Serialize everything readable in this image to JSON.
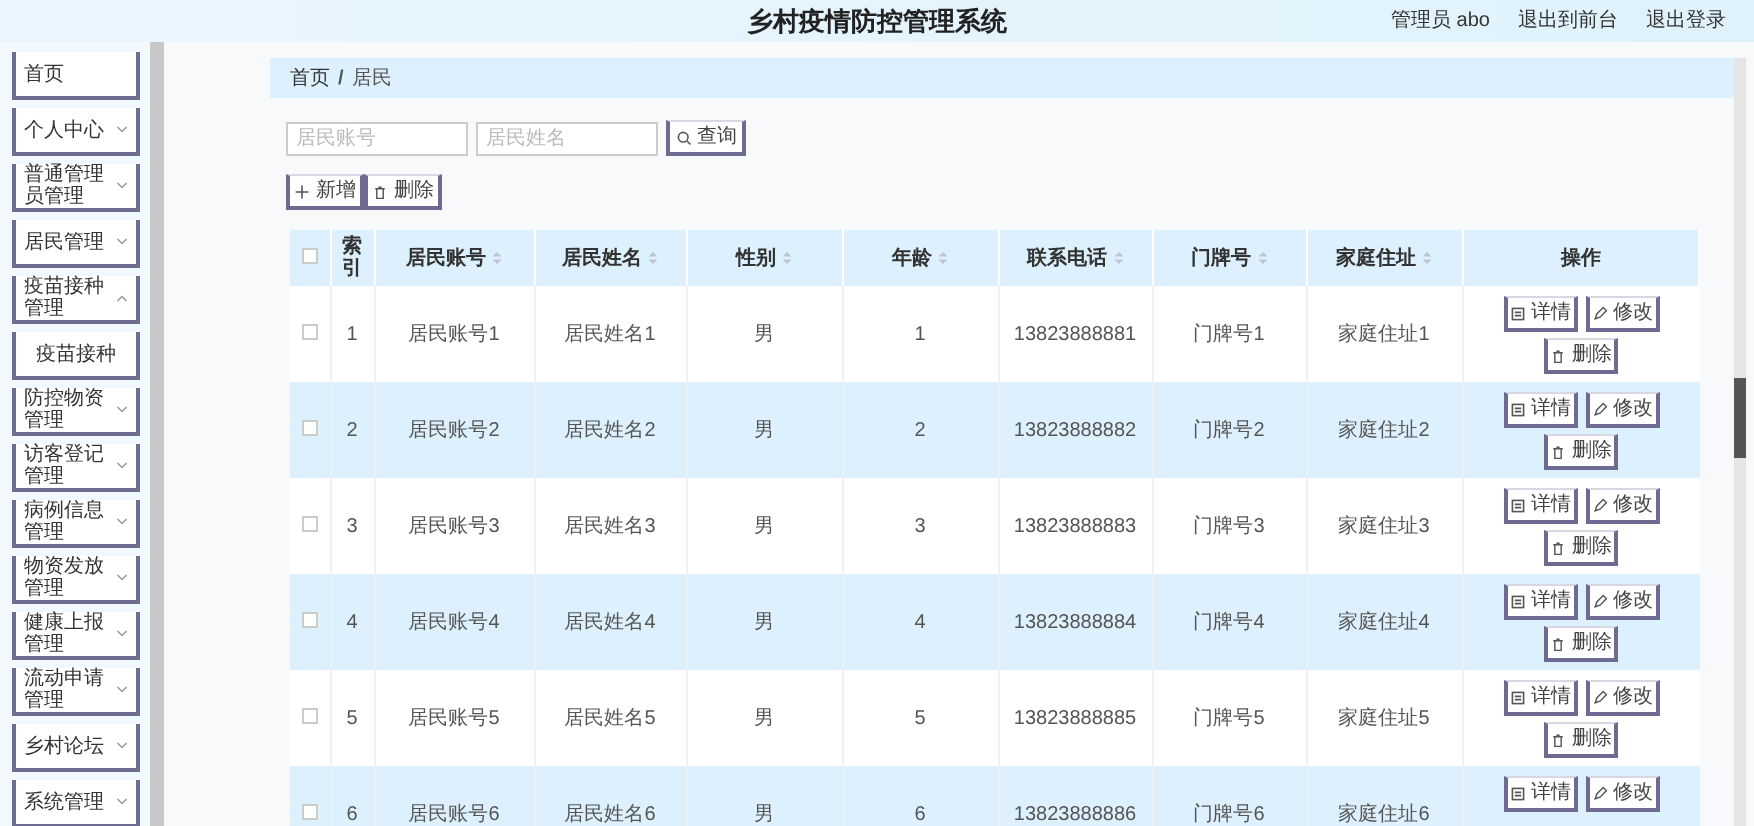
{
  "header": {
    "title": "乡村疫情防控管理系统",
    "links": [
      "管理员 abo",
      "退出到前台",
      "退出登录"
    ]
  },
  "sidebar": {
    "items": [
      {
        "label": "首页",
        "kind": "link"
      },
      {
        "label": "个人中心",
        "kind": "menu",
        "expanded": false
      },
      {
        "label": "普通管理员管理",
        "kind": "menu",
        "expanded": false
      },
      {
        "label": "居民管理",
        "kind": "menu",
        "expanded": false
      },
      {
        "label": "疫苗接种管理",
        "kind": "menu",
        "expanded": true,
        "children": [
          {
            "label": "疫苗接种"
          }
        ]
      },
      {
        "label": "防控物资管理",
        "kind": "menu",
        "expanded": false
      },
      {
        "label": "访客登记管理",
        "kind": "menu",
        "expanded": false
      },
      {
        "label": "病例信息管理",
        "kind": "menu",
        "expanded": false
      },
      {
        "label": "物资发放管理",
        "kind": "menu",
        "expanded": false
      },
      {
        "label": "健康上报管理",
        "kind": "menu",
        "expanded": false
      },
      {
        "label": "流动申请管理",
        "kind": "menu",
        "expanded": false
      },
      {
        "label": "乡村论坛",
        "kind": "menu",
        "expanded": false
      },
      {
        "label": "系统管理",
        "kind": "menu",
        "expanded": false
      }
    ]
  },
  "breadcrumb": {
    "items": [
      "首页",
      "居民"
    ],
    "separator": "/"
  },
  "search": {
    "fields": [
      {
        "placeholder": "居民账号"
      },
      {
        "placeholder": "居民姓名"
      }
    ],
    "button": "查询"
  },
  "toolbar": [
    {
      "label": "新增",
      "kind": "add"
    },
    {
      "label": "删除",
      "kind": "delete"
    }
  ],
  "table": {
    "columns": [
      {
        "label": "索引",
        "sortable": false
      },
      {
        "label": "居民账号",
        "sortable": true
      },
      {
        "label": "居民姓名",
        "sortable": true
      },
      {
        "label": "性别",
        "sortable": true
      },
      {
        "label": "年龄",
        "sortable": true
      },
      {
        "label": "联系电话",
        "sortable": true
      },
      {
        "label": "门牌号",
        "sortable": true
      },
      {
        "label": "家庭住址",
        "sortable": true
      },
      {
        "label": "操作",
        "sortable": false
      }
    ],
    "header_checked": false,
    "rows": [
      {
        "checked": false,
        "cells": [
          "1",
          "居民账号1",
          "居民姓名1",
          "男",
          "1",
          "13823888881",
          "门牌号1",
          "家庭住址1"
        ],
        "actions": [
          {
            "label": "详情",
            "kind": "detail"
          },
          {
            "label": "修改",
            "kind": "edit"
          },
          {
            "label": "删除",
            "kind": "delete"
          }
        ]
      },
      {
        "checked": false,
        "cells": [
          "2",
          "居民账号2",
          "居民姓名2",
          "男",
          "2",
          "13823888882",
          "门牌号2",
          "家庭住址2"
        ],
        "actions": [
          {
            "label": "详情",
            "kind": "detail"
          },
          {
            "label": "修改",
            "kind": "edit"
          },
          {
            "label": "删除",
            "kind": "delete"
          }
        ]
      },
      {
        "checked": false,
        "cells": [
          "3",
          "居民账号3",
          "居民姓名3",
          "男",
          "3",
          "13823888883",
          "门牌号3",
          "家庭住址3"
        ],
        "actions": [
          {
            "label": "详情",
            "kind": "detail"
          },
          {
            "label": "修改",
            "kind": "edit"
          },
          {
            "label": "删除",
            "kind": "delete"
          }
        ]
      },
      {
        "checked": false,
        "cells": [
          "4",
          "居民账号4",
          "居民姓名4",
          "男",
          "4",
          "13823888884",
          "门牌号4",
          "家庭住址4"
        ],
        "actions": [
          {
            "label": "详情",
            "kind": "detail"
          },
          {
            "label": "修改",
            "kind": "edit"
          },
          {
            "label": "删除",
            "kind": "delete"
          }
        ]
      },
      {
        "checked": false,
        "cells": [
          "5",
          "居民账号5",
          "居民姓名5",
          "男",
          "5",
          "13823888885",
          "门牌号5",
          "家庭住址5"
        ],
        "actions": [
          {
            "label": "详情",
            "kind": "detail"
          },
          {
            "label": "修改",
            "kind": "edit"
          },
          {
            "label": "删除",
            "kind": "delete"
          }
        ]
      },
      {
        "checked": false,
        "cells": [
          "6",
          "居民账号6",
          "居民姓名6",
          "男",
          "6",
          "13823888886",
          "门牌号6",
          "家庭住址6"
        ],
        "actions": [
          {
            "label": "详情",
            "kind": "detail"
          },
          {
            "label": "修改",
            "kind": "edit"
          }
        ]
      }
    ]
  }
}
